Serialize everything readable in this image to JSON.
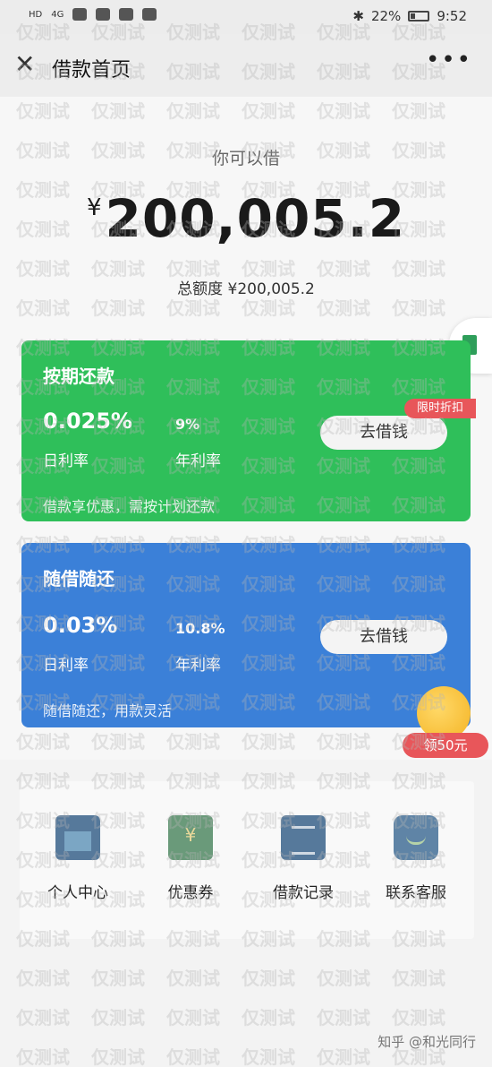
{
  "status_bar": {
    "network": "HD",
    "signal": "4G",
    "battery_percent": "22%",
    "time": "9:52"
  },
  "nav": {
    "title": "借款首页",
    "close_icon": "close-icon",
    "more_icon": "more-icon"
  },
  "header": {
    "can_borrow_label": "你可以借",
    "currency": "¥",
    "amount": "200,005.2",
    "total_limit": "总额度 ¥200,005.2"
  },
  "cards": [
    {
      "title": "按期还款",
      "daily_rate": "0.025%",
      "daily_rate_label": "日利率",
      "annual_rate": "9%",
      "annual_rate_label": "年利率",
      "button": "去借钱",
      "description": "借款享优惠，需按计划还款",
      "tag": "限时折扣",
      "color": "#2fbf5a"
    },
    {
      "title": "随借随还",
      "daily_rate": "0.03%",
      "daily_rate_label": "日利率",
      "annual_rate": "10.8%",
      "annual_rate_label": "年利率",
      "button": "去借钱",
      "description": "随借随还，用款灵活",
      "color": "#3b80d8"
    }
  ],
  "coupon_tag": "领50元",
  "bottom_nav": [
    {
      "label": "个人中心",
      "icon": "personal-center-icon"
    },
    {
      "label": "优惠券",
      "icon": "coupon-icon"
    },
    {
      "label": "借款记录",
      "icon": "loan-record-icon"
    },
    {
      "label": "联系客服",
      "icon": "customer-service-icon"
    }
  ],
  "watermark": "仅测试",
  "footer_credit": "知乎 @和光同行"
}
